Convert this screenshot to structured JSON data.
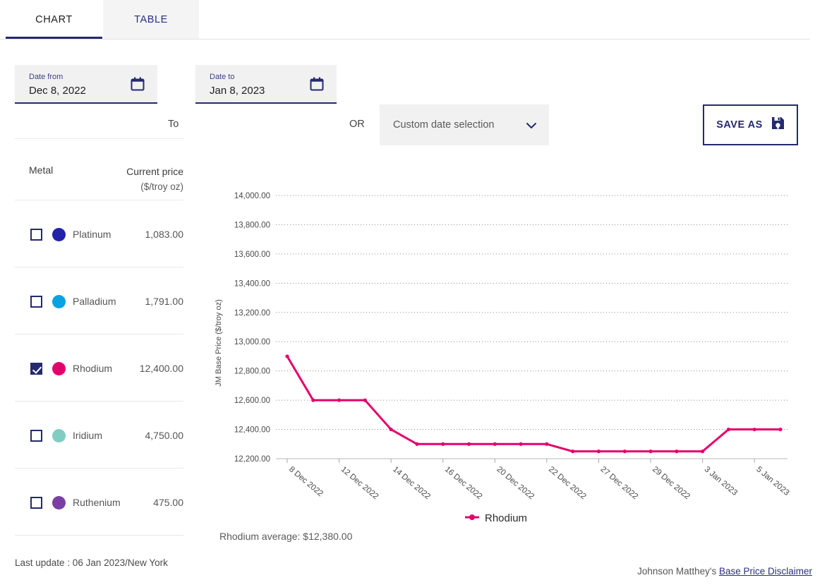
{
  "tabs": [
    {
      "label": "CHART",
      "active": true
    },
    {
      "label": "TABLE",
      "active": false
    }
  ],
  "filters": {
    "date_from_label": "Date from",
    "date_from_value": "Dec 8, 2022",
    "to_word": "To",
    "date_to_label": "Date to",
    "date_to_value": "Jan 8, 2023",
    "or_word": "OR",
    "custom_selection": "Custom date selection",
    "save_as_label": "SAVE AS"
  },
  "table": {
    "header_metal": "Metal",
    "header_price": "Current price",
    "header_price_unit": "($/troy oz)",
    "rows": [
      {
        "name": "Platinum",
        "price": "1,083.00",
        "color": "#2222aa",
        "checked": false
      },
      {
        "name": "Palladium",
        "price": "1,791.00",
        "color": "#0aa3e2",
        "checked": false
      },
      {
        "name": "Rhodium",
        "price": "12,400.00",
        "color": "#e4006b",
        "checked": true
      },
      {
        "name": "Iridium",
        "price": "4,750.00",
        "color": "#82cdc2",
        "checked": false
      },
      {
        "name": "Ruthenium",
        "price": "475.00",
        "color": "#7b3fa3",
        "checked": false
      }
    ]
  },
  "last_update": "Last update : 06 Jan 2023/New York",
  "average_text": "Rhodium average: $12,380.00",
  "footer": {
    "prefix": "Johnson Matthey's ",
    "link": "Base Price Disclaimer"
  },
  "chart_data": {
    "type": "line",
    "title": "",
    "xlabel": "",
    "ylabel": "JM Base Price ($/troy oz)",
    "ylim": [
      12200,
      14000
    ],
    "ytick_step": 200,
    "ytick_labels": [
      "14,000.00",
      "13,800.00",
      "13,600.00",
      "13,400.00",
      "13,200.00",
      "13,000.00",
      "12,800.00",
      "12,600.00",
      "12,400.00",
      "12,200.00"
    ],
    "grid": true,
    "legend": [
      {
        "name": "Rhodium",
        "color": "#e4006b"
      }
    ],
    "legend_position": "bottom",
    "xtick_labels": [
      "8 Dec 2022",
      "12 Dec 2022",
      "14 Dec 2022",
      "16 Dec 2022",
      "20 Dec 2022",
      "22 Dec 2022",
      "27 Dec 2022",
      "29 Dec 2022",
      "3 Jan 2023",
      "5 Jan 2023"
    ],
    "series": [
      {
        "name": "Rhodium",
        "color": "#e4006b",
        "values": [
          12900,
          12600,
          12600,
          12600,
          12400,
          12300,
          12300,
          12300,
          12300,
          12300,
          12300,
          12250,
          12250,
          12250,
          12250,
          12250,
          12250,
          12400,
          12400,
          12400
        ]
      }
    ]
  }
}
